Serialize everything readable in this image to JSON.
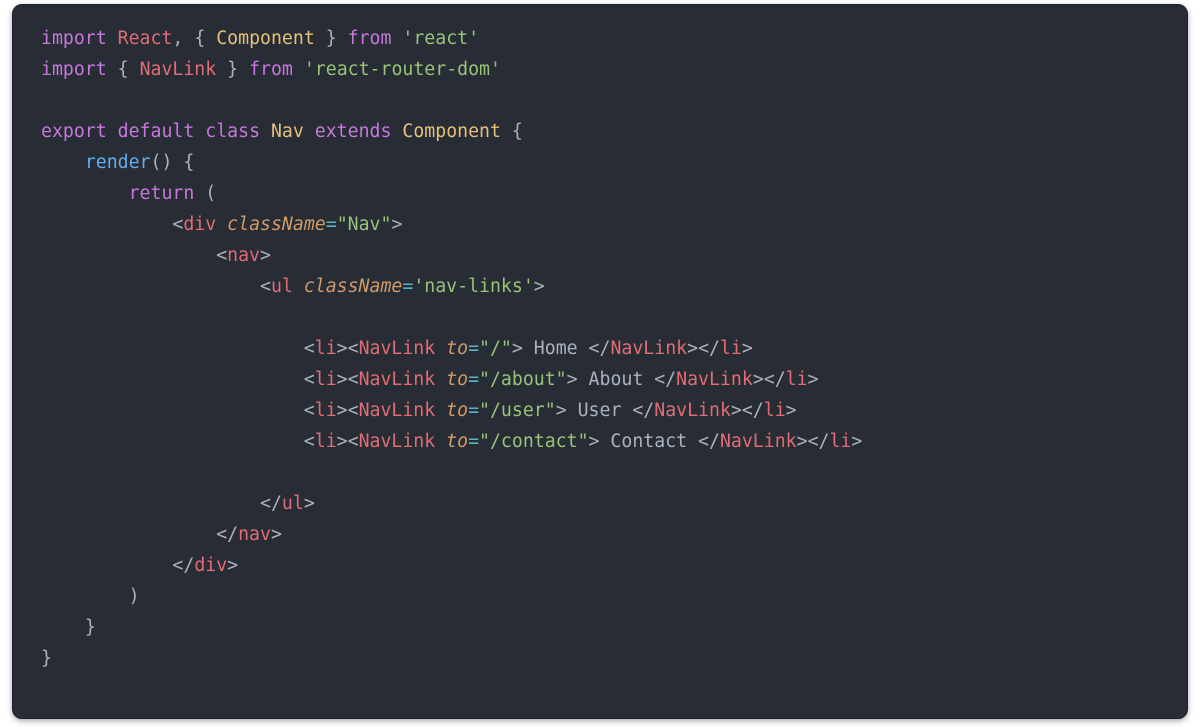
{
  "imports": {
    "line1": {
      "kw_import": "import",
      "React": "React",
      "comma": ",",
      "brace_open": "{",
      "Component": "Component",
      "brace_close": "}",
      "kw_from": "from",
      "pkg": "'react'"
    },
    "line2": {
      "kw_import": "import",
      "brace_open": "{",
      "NavLink": "NavLink",
      "brace_close": "}",
      "kw_from": "from",
      "pkg": "'react-router-dom'"
    }
  },
  "decl": {
    "kw_export": "export",
    "kw_default": "default",
    "kw_class": "class",
    "Nav": "Nav",
    "kw_extends": "extends",
    "Component": "Component",
    "brace_open": "{"
  },
  "render": {
    "name": "render",
    "parens": "()",
    "brace_open": "{",
    "kw_return": "return",
    "paren_open": "(",
    "paren_close": ")",
    "brace_close": "}"
  },
  "jsx": {
    "div_open_lt": "<",
    "div_tag": "div",
    "className_attr": "className",
    "eq": "=",
    "div_className_val": "\"Nav\"",
    "gt": ">",
    "nav_tag": "nav",
    "ul_tag": "ul",
    "ul_className_val": "'nav-links'",
    "li_tag": "li",
    "NavLink_tag": "NavLink",
    "to_attr": "to",
    "links": [
      {
        "to": "\"/\"",
        "text": " Home "
      },
      {
        "to": "\"/about\"",
        "text": " About "
      },
      {
        "to": "\"/user\"",
        "text": " User "
      },
      {
        "to": "\"/contact\"",
        "text": " Contact "
      }
    ],
    "close_lt": "</",
    "div_close": "div",
    "nav_close": "nav",
    "ul_close": "ul",
    "li_close": "li",
    "NavLink_close": "NavLink"
  },
  "closing": {
    "brace": "}"
  }
}
